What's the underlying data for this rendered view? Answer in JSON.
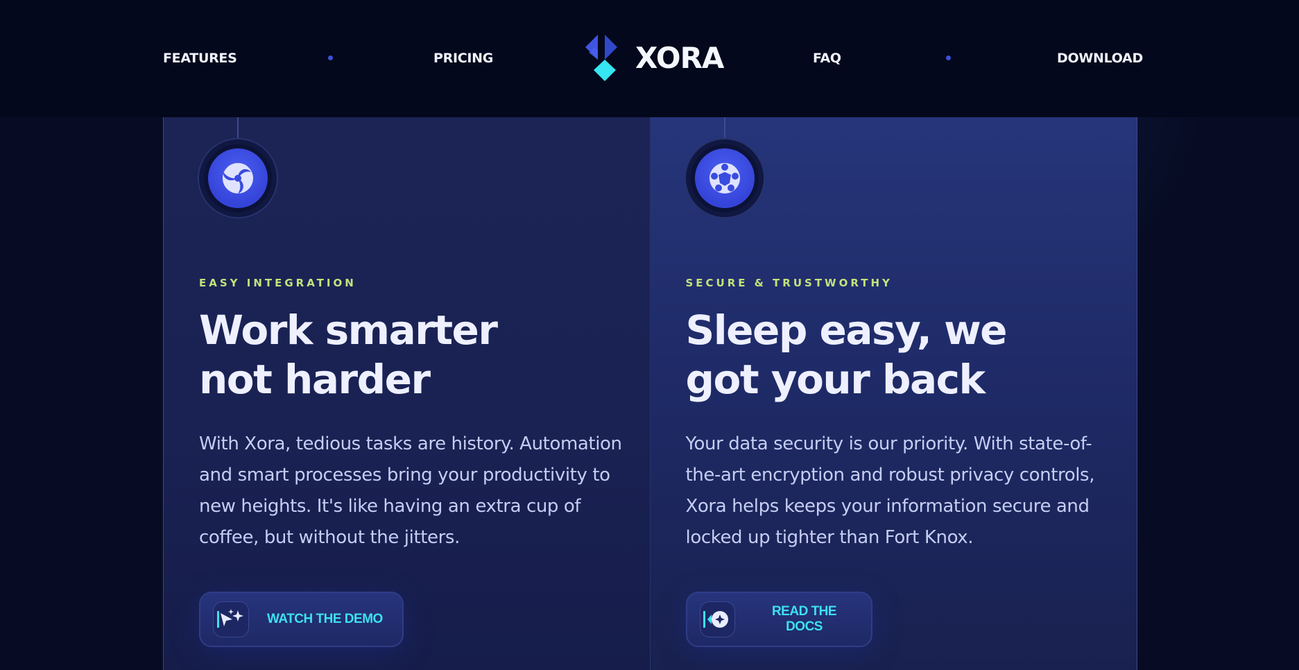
{
  "nav": {
    "left_links": [
      "FEATURES",
      "PRICING"
    ],
    "right_links": [
      "FAQ",
      "DOWNLOAD"
    ],
    "logo_text": "XORA"
  },
  "cards": [
    {
      "icon": "swirl-icon",
      "eyebrow": "EASY INTEGRATION",
      "headline_line1": "Work smarter",
      "headline_line2": "not harder",
      "body": "With Xora, tedious tasks are history. Automation and smart processes bring your productivity to new heights. It's like having an extra cup of coffee, but without the jitters.",
      "button_label": "WATCH THE DEMO",
      "button_icon": "sparkle-cursor-icon"
    },
    {
      "icon": "shield-network-icon",
      "eyebrow": "SECURE & TRUSTWORTHY",
      "headline_line1": "Sleep easy, we",
      "headline_line2": "got your back",
      "body": "Your data security is our priority. With state-of-the-art encryption and robust privacy controls, Xora helps keeps your information secure and locked up tighter than Fort Knox.",
      "button_label": "READ THE DOCS",
      "button_icon": "docs-badge-icon"
    }
  ],
  "colors": {
    "accent_cyan": "#3ee0ef",
    "eyebrow_green": "#c3e37a",
    "brand_blue": "#3c4fd8"
  }
}
